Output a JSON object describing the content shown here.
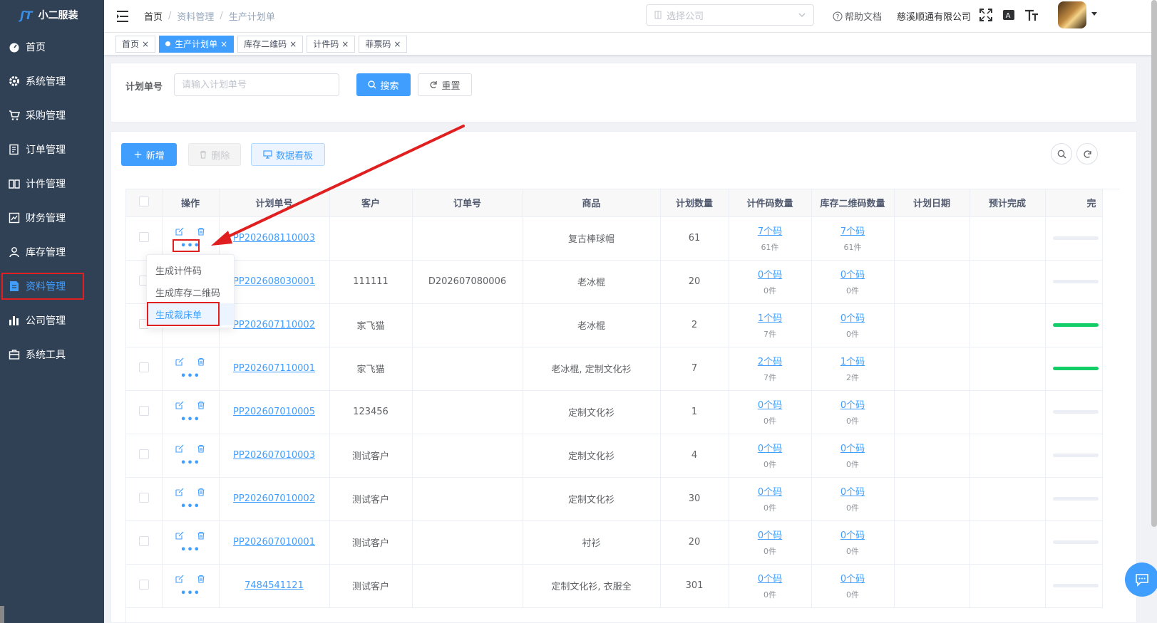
{
  "app": {
    "logo_text": "小二服装"
  },
  "sidebar": {
    "items": [
      {
        "label": "首页",
        "icon": "dashboard-icon"
      },
      {
        "label": "系统管理",
        "icon": "gear-icon"
      },
      {
        "label": "采购管理",
        "icon": "cart-icon"
      },
      {
        "label": "订单管理",
        "icon": "order-icon"
      },
      {
        "label": "计件管理",
        "icon": "book-icon"
      },
      {
        "label": "财务管理",
        "icon": "chart-box-icon"
      },
      {
        "label": "库存管理",
        "icon": "user-icon"
      },
      {
        "label": "资料管理",
        "icon": "document-icon",
        "active": true
      },
      {
        "label": "公司管理",
        "icon": "bar-chart-icon"
      },
      {
        "label": "系统工具",
        "icon": "toolbox-icon"
      }
    ]
  },
  "header": {
    "breadcrumb": [
      "首页",
      "资料管理",
      "生产计划单"
    ],
    "company_placeholder": "选择公司",
    "help": "帮助文档",
    "company_name": "慈溪顺通有限公司"
  },
  "tags": [
    {
      "label": "首页",
      "active": false
    },
    {
      "label": "生产计划单",
      "active": true
    },
    {
      "label": "库存二维码",
      "active": false
    },
    {
      "label": "计件码",
      "active": false
    },
    {
      "label": "菲票码",
      "active": false
    }
  ],
  "search": {
    "label": "计划单号",
    "placeholder": "请输入计划单号",
    "search_btn": "搜索",
    "reset_btn": "重置"
  },
  "toolbar": {
    "add": "新增",
    "delete": "删除",
    "board": "数据看板"
  },
  "table": {
    "columns": [
      "操作",
      "计划单号",
      "客户",
      "订单号",
      "商品",
      "计划数量",
      "计件码数量",
      "库存二维码数量",
      "计划日期",
      "预计完成",
      "完"
    ],
    "rows": [
      {
        "plan_no": "PP202608110003",
        "customer": "",
        "order_no": "",
        "product": "复古棒球帽",
        "qty": "61",
        "piece_codes": "7个码",
        "piece_count": "61件",
        "stock_codes": "7个码",
        "stock_count": "61件",
        "progress": 0
      },
      {
        "plan_no": "PP202608030001",
        "customer": "111111",
        "order_no": "D202607080006",
        "product": "老冰棍",
        "qty": "20",
        "piece_codes": "0个码",
        "piece_count": "0件",
        "stock_codes": "0个码",
        "stock_count": "0件",
        "progress": 0
      },
      {
        "plan_no": "PP202607110002",
        "customer": "家飞猫",
        "order_no": "",
        "product": "老冰棍",
        "qty": "2",
        "piece_codes": "1个码",
        "piece_count": "7件",
        "stock_codes": "0个码",
        "stock_count": "0件",
        "progress": 1
      },
      {
        "plan_no": "PP202607110001",
        "customer": "家飞猫",
        "order_no": "",
        "product": "老冰棍, 定制文化衫",
        "qty": "7",
        "piece_codes": "2个码",
        "piece_count": "7件",
        "stock_codes": "1个码",
        "stock_count": "2件",
        "progress": 1
      },
      {
        "plan_no": "PP202607010005",
        "customer": "123456",
        "order_no": "",
        "product": "定制文化衫",
        "qty": "1",
        "piece_codes": "0个码",
        "piece_count": "0件",
        "stock_codes": "0个码",
        "stock_count": "0件",
        "progress": 0
      },
      {
        "plan_no": "PP202607010003",
        "customer": "测试客户",
        "order_no": "",
        "product": "定制文化衫",
        "qty": "4",
        "piece_codes": "0个码",
        "piece_count": "0件",
        "stock_codes": "0个码",
        "stock_count": "0件",
        "progress": 0
      },
      {
        "plan_no": "PP202607010002",
        "customer": "测试客户",
        "order_no": "",
        "product": "定制文化衫",
        "qty": "30",
        "piece_codes": "0个码",
        "piece_count": "0件",
        "stock_codes": "0个码",
        "stock_count": "0件",
        "progress": 0
      },
      {
        "plan_no": "PP202607010001",
        "customer": "测试客户",
        "order_no": "",
        "product": "衬衫",
        "qty": "20",
        "piece_codes": "0个码",
        "piece_count": "0件",
        "stock_codes": "0个码",
        "stock_count": "0件",
        "progress": 0
      },
      {
        "plan_no": "7484541121",
        "customer": "测试客户",
        "order_no": "",
        "product": "定制文化衫, 衣服全",
        "qty": "301",
        "piece_codes": "0个码",
        "piece_count": "0件",
        "stock_codes": "0个码",
        "stock_count": "0件",
        "progress": 0
      }
    ]
  },
  "dropdown": {
    "items": [
      "生成计件码",
      "生成库存二维码",
      "生成裁床单"
    ],
    "highlighted_index": 2
  },
  "colors": {
    "primary": "#409eff",
    "sidebar_bg": "#304156",
    "annotation_red": "#e02020",
    "progress_done": "#13ce66"
  }
}
